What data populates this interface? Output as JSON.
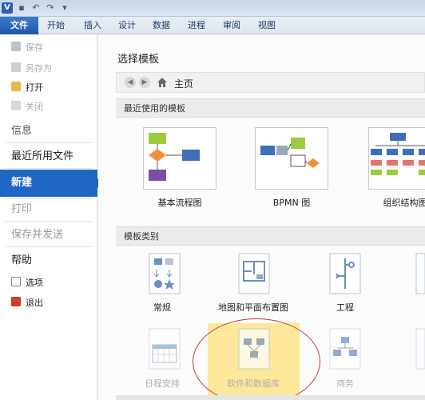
{
  "titlebar": {
    "app_icon_letter": "V",
    "qat": [
      "save-icon",
      "undo-icon",
      "redo-icon",
      "customize-icon"
    ]
  },
  "ribbon": {
    "tabs": [
      "文件",
      "开始",
      "插入",
      "设计",
      "数据",
      "进程",
      "审阅",
      "视图"
    ]
  },
  "nav": {
    "items": {
      "save": "保存",
      "save_as": "另存为",
      "open": "打开",
      "close": "关闭",
      "info": "信息",
      "recent": "最近所用文件",
      "new": "新建",
      "print": "打印",
      "share": "保存并发送",
      "help": "帮助",
      "options": "选项",
      "exit": "退出"
    }
  },
  "main": {
    "title": "选择模板",
    "breadcrumb": "主页",
    "recent_header": "最近使用的模板",
    "recent": [
      "基本流程图",
      "BPMN 图",
      "组织结构图"
    ],
    "categories_header": "模板类别",
    "categories_row1": [
      "常规",
      "地图和平面布置图",
      "工程"
    ],
    "categories_row2": [
      "日程安排",
      "软件和数据库",
      "商务"
    ]
  },
  "colors": {
    "accent": "#1f66c2",
    "highlight": "#fde48a",
    "annotation": "#c23a3a"
  }
}
